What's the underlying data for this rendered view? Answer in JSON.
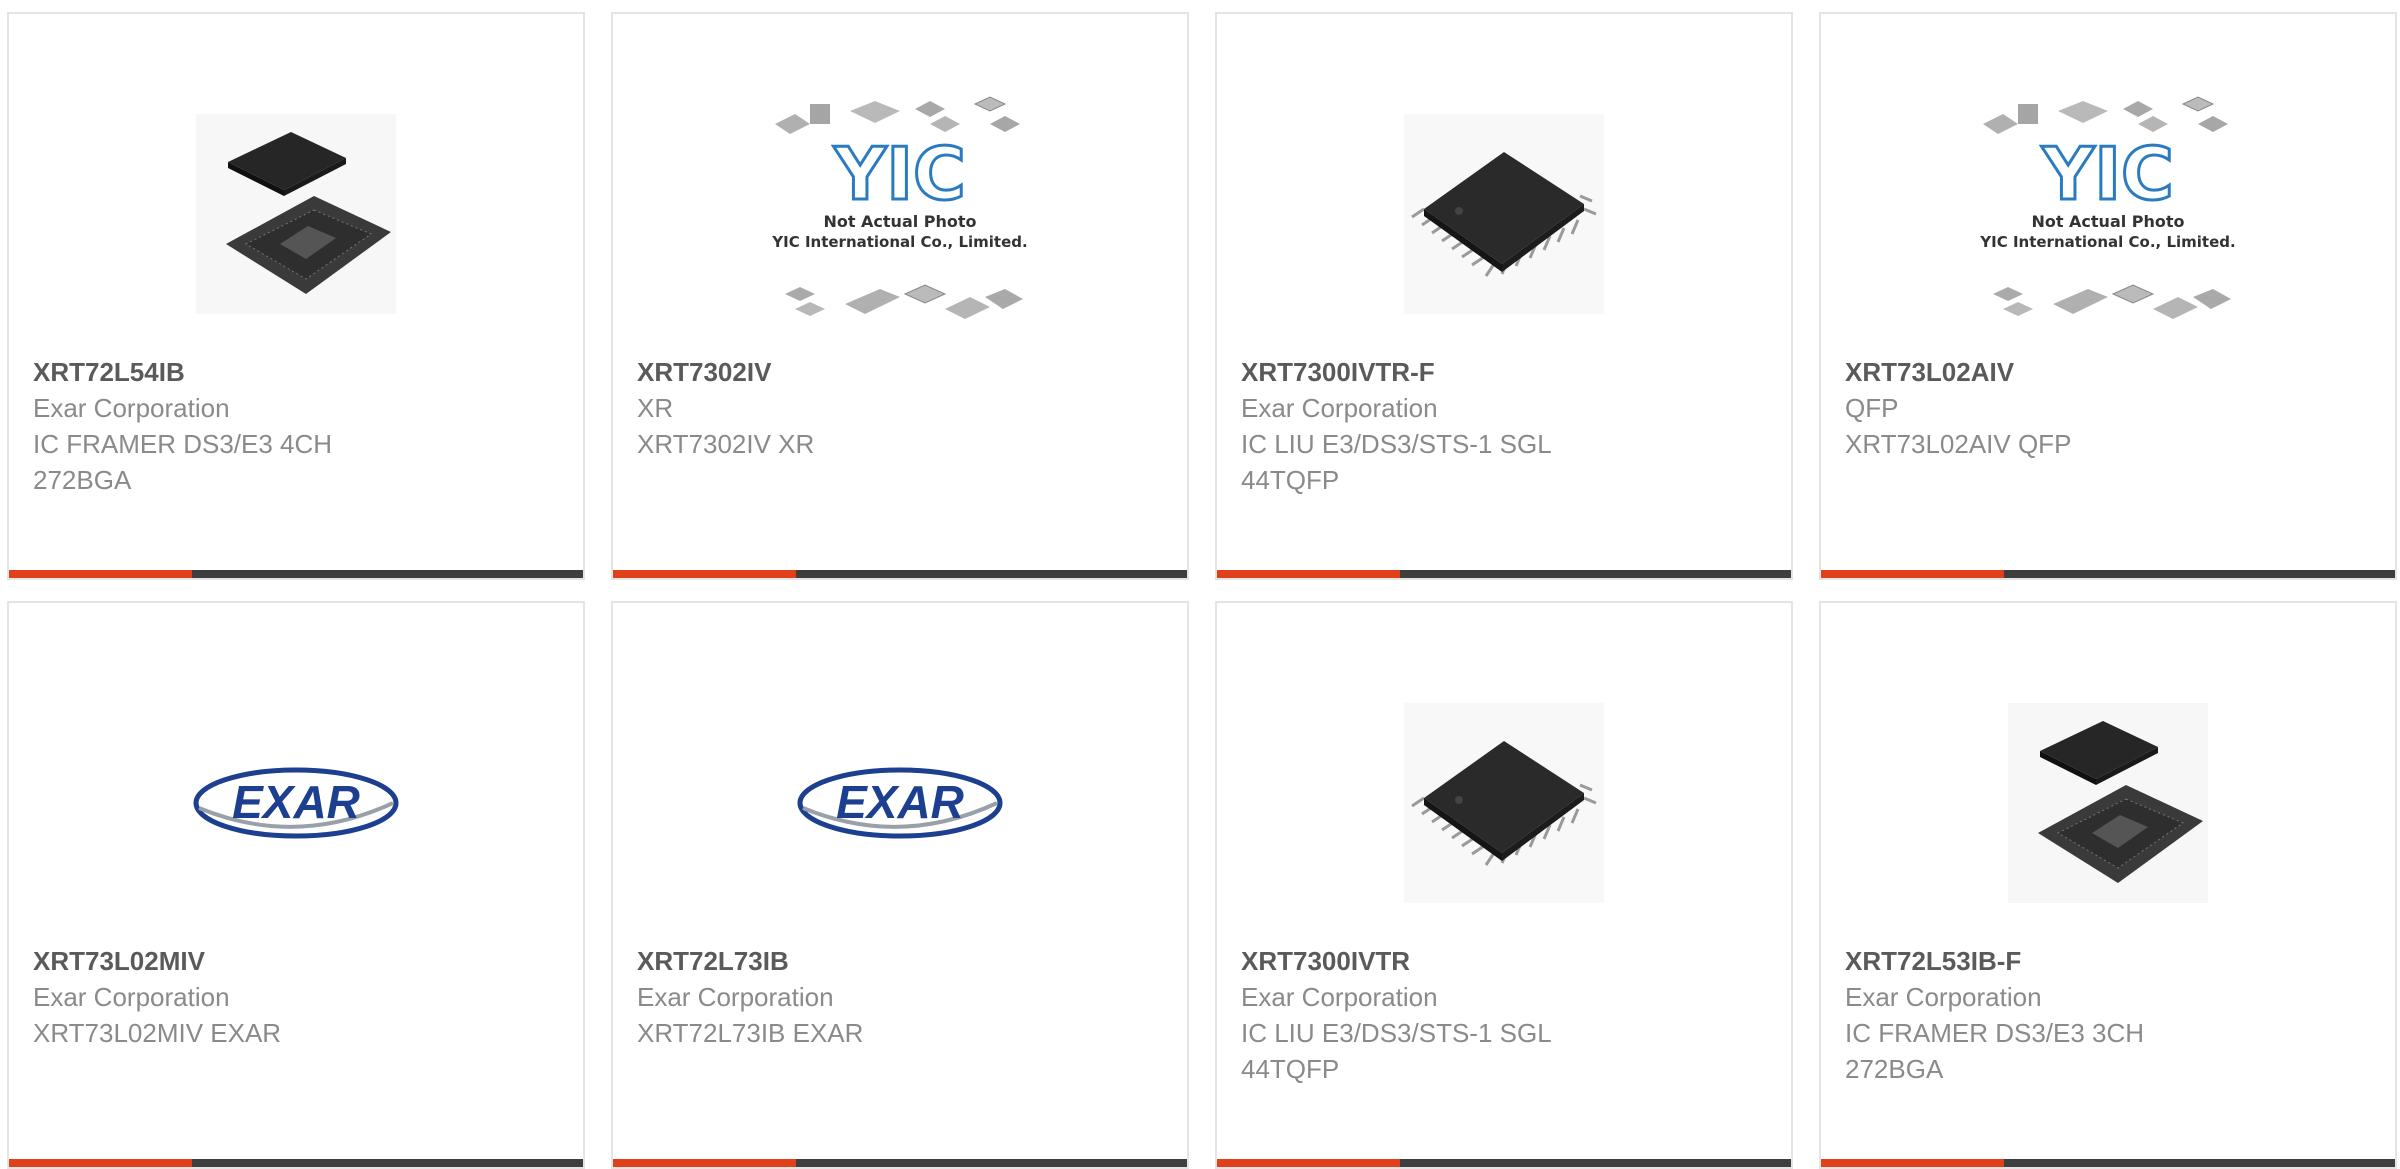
{
  "colors": {
    "accent": "#e0401a",
    "bar": "#3e3e3e",
    "border": "#e4e4e4",
    "part_number": "#5a5a5a",
    "description": "#8a8a8a",
    "exar_logo": "#1d3f8f"
  },
  "products": [
    {
      "part_number": "XRT72L54IB",
      "lines": [
        "Exar Corporation",
        "IC FRAMER DS3/E3 4CH",
        "272BGA"
      ],
      "image": "bga-package-icon"
    },
    {
      "part_number": "XRT7302IV",
      "lines": [
        "XR",
        "XRT7302IV XR"
      ],
      "image": "yic-placeholder-icon",
      "placeholder_text": [
        "Not Actual Photo",
        "YIC International Co., Limited."
      ],
      "placeholder_logo": "YIC"
    },
    {
      "part_number": "XRT7300IVTR-F",
      "lines": [
        "Exar Corporation",
        "IC LIU E3/DS3/STS-1 SGL",
        "44TQFP"
      ],
      "image": "tqfp-chip-icon"
    },
    {
      "part_number": "XRT73L02AIV",
      "lines": [
        "QFP",
        "XRT73L02AIV QFP"
      ],
      "image": "yic-placeholder-icon",
      "placeholder_text": [
        "Not Actual Photo",
        "YIC International Co., Limited."
      ],
      "placeholder_logo": "YIC"
    },
    {
      "part_number": "XRT73L02MIV",
      "lines": [
        "Exar Corporation",
        "XRT73L02MIV EXAR"
      ],
      "image": "exar-logo",
      "logo_text": "EXAR"
    },
    {
      "part_number": "XRT72L73IB",
      "lines": [
        "Exar Corporation",
        "XRT72L73IB EXAR"
      ],
      "image": "exar-logo",
      "logo_text": "EXAR"
    },
    {
      "part_number": "XRT7300IVTR",
      "lines": [
        "Exar Corporation",
        "IC LIU E3/DS3/STS-1 SGL",
        "44TQFP"
      ],
      "image": "tqfp-chip-icon"
    },
    {
      "part_number": "XRT72L53IB-F",
      "lines": [
        "Exar Corporation",
        "IC FRAMER DS3/E3 3CH",
        "272BGA"
      ],
      "image": "bga-package-icon"
    }
  ]
}
